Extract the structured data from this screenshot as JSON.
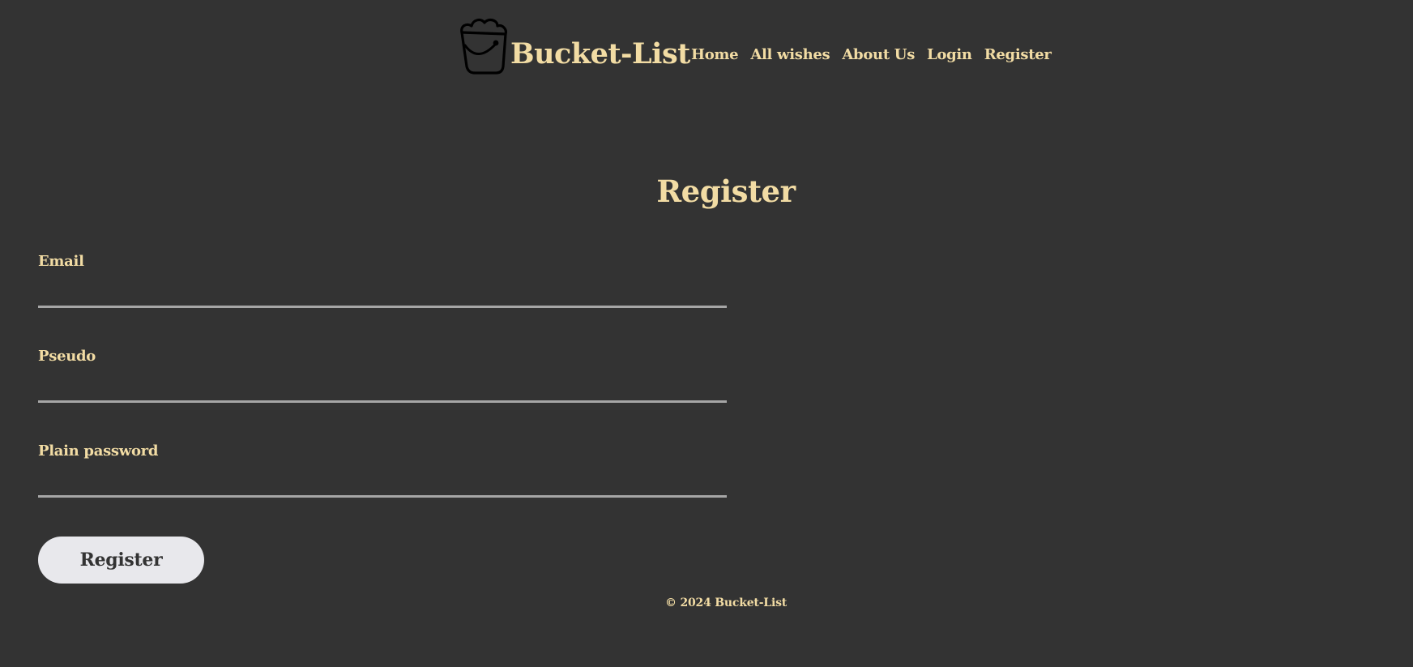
{
  "header": {
    "logo_icon": "bucket-icon",
    "brand": "Bucket-List",
    "nav": [
      {
        "label": "Home"
      },
      {
        "label": "All wishes"
      },
      {
        "label": "About Us"
      },
      {
        "label": "Login"
      },
      {
        "label": "Register"
      }
    ]
  },
  "main": {
    "title": "Register",
    "fields": [
      {
        "label": "Email",
        "value": ""
      },
      {
        "label": "Pseudo",
        "value": ""
      },
      {
        "label": "Plain password",
        "value": ""
      }
    ],
    "submit_label": "Register"
  },
  "footer": {
    "copyright": "© 2024 Bucket-List"
  },
  "colors": {
    "background": "#333333",
    "accent": "#f2dca4",
    "input_underline": "#a6a6a6",
    "button_bg": "#e8e8ec",
    "button_text": "#333333"
  }
}
